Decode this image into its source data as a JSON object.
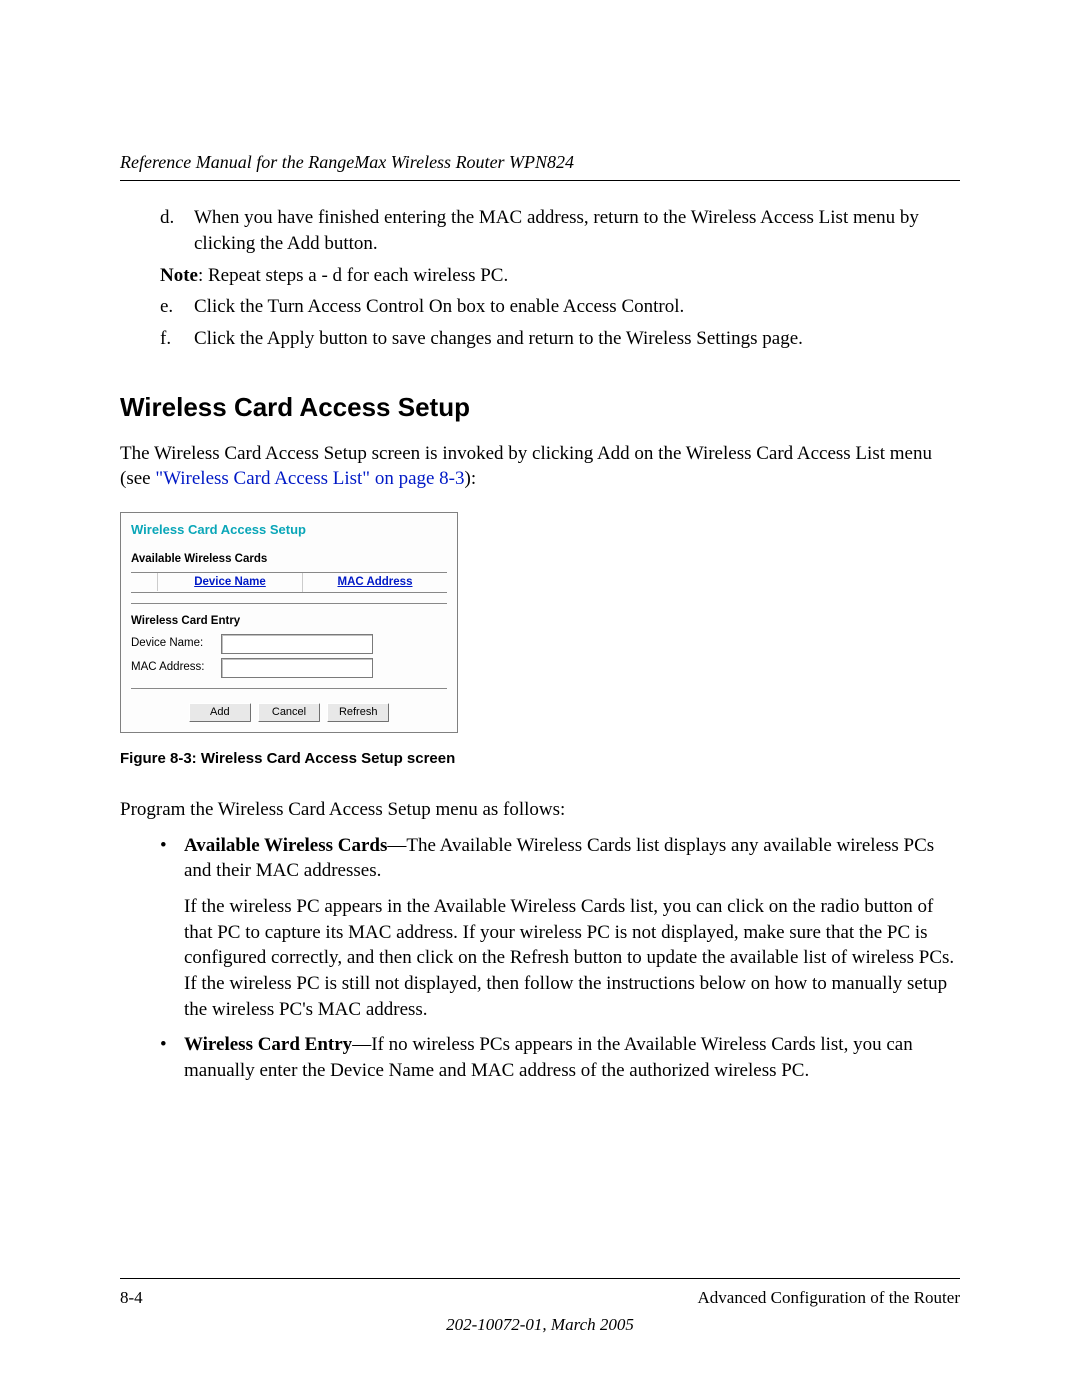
{
  "header": {
    "running_title": "Reference Manual for the RangeMax Wireless Router WPN824"
  },
  "steps": {
    "d": {
      "marker": "d.",
      "text": "When you have finished entering the MAC address, return to the Wireless Access List menu by clicking the Add button."
    },
    "note": {
      "bold": "Note",
      "text": ": Repeat steps a - d for each wireless PC."
    },
    "e": {
      "marker": "e.",
      "text": "Click the Turn Access Control On box to enable Access Control."
    },
    "f": {
      "marker": "f.",
      "text": "Click the Apply button to save changes and return to the Wireless Settings page."
    }
  },
  "section_title": "Wireless Card Access Setup",
  "intro": {
    "pre_link": "The Wireless Card Access Setup screen is invoked by clicking Add on the Wireless Card Access List menu (see ",
    "link": "\"Wireless Card Access List\" on page 8-3",
    "post_link": "):"
  },
  "figure": {
    "title": "Wireless Card Access Setup",
    "available_heading": "Available Wireless Cards",
    "col_device": "Device Name",
    "col_mac": "MAC Address",
    "entry_heading": "Wireless Card Entry",
    "label_device": "Device Name:",
    "label_mac": "MAC Address:",
    "btn_add": "Add",
    "btn_cancel": "Cancel",
    "btn_refresh": "Refresh",
    "caption": "Figure 8-3:  Wireless Card Access Setup screen"
  },
  "program_intro": "Program the Wireless Card Access Setup menu as follows:",
  "bullets": {
    "a": {
      "bold": "Available Wireless Cards",
      "text": "—The Available Wireless Cards list displays any available wireless PCs and their MAC addresses.",
      "sub": "If the wireless PC appears in the Available Wireless Cards list, you can click on the radio button of that PC to capture its MAC address. If your wireless PC is not displayed, make sure that the PC is configured correctly, and then click on the Refresh button to update the available list of wireless PCs. If the wireless PC is still not displayed, then follow the instructions below on how to manually setup the wireless PC's MAC address."
    },
    "b": {
      "bold": "Wireless Card Entry",
      "text": "—If no wireless PCs appears in the Available Wireless Cards list, you can manually enter the Device Name and MAC address of the authorized wireless PC."
    }
  },
  "footer": {
    "page": "8-4",
    "chapter": "Advanced Configuration of the Router",
    "docid": "202-10072-01, March 2005"
  }
}
